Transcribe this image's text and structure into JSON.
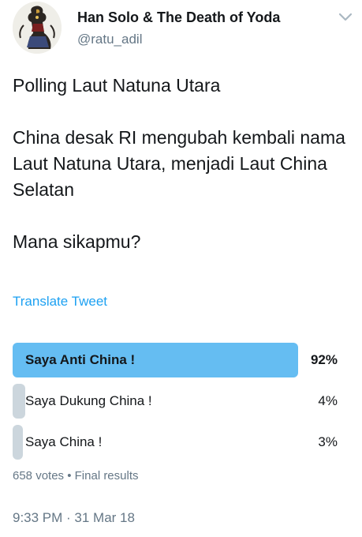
{
  "author": {
    "name": "Han Solo & The Death of Yoda",
    "handle": "@ratu_adil",
    "avatar_icon": "wayang-puppet-avatar"
  },
  "tweet": {
    "line1": "Polling Laut Natuna Utara",
    "line2": "China desak RI mengubah kembali nama Laut Natuna Utara, menjadi Laut China Selatan",
    "line3": "Mana sikapmu?"
  },
  "translate_label": "Translate Tweet",
  "poll": {
    "options": [
      {
        "label": "Saya Anti China !",
        "percent": "92%",
        "share": 0.92,
        "winner": true
      },
      {
        "label": "Saya Dukung China !",
        "percent": "4%",
        "share": 0.04,
        "winner": false
      },
      {
        "label": "Saya China !",
        "percent": "3%",
        "share": 0.03,
        "winner": false
      }
    ],
    "meta": "658 votes • Final results"
  },
  "timestamp": "9:33 PM · 31 Mar 18",
  "colors": {
    "winner_bar": "#65bdf2",
    "loser_bar": "#ccd6dd",
    "link": "#1da1f2",
    "muted": "#657786"
  }
}
